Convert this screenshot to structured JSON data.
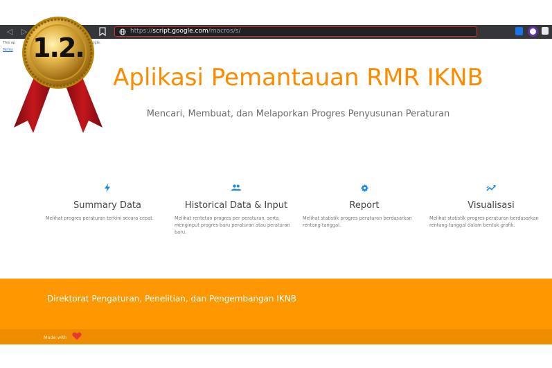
{
  "browser": {
    "url_prefix": "https://",
    "url_domain": "script.google.com",
    "url_path": "/macros/s/"
  },
  "banner": {
    "warning_fragment": "This ap",
    "warning_suffix": "ot by Google.",
    "terms_label": "Terms"
  },
  "badge": {
    "label": "1.2."
  },
  "header": {
    "title": "Aplikasi Pemantauan RMR IKNB",
    "subtitle": "Mencari, Membuat, dan Melaporkan Progres Penyusunan Peraturan"
  },
  "features": [
    {
      "icon": "bolt-icon",
      "title": "Summary Data",
      "description": "Melihat progres peraturan terkini secara cepat."
    },
    {
      "icon": "group-icon",
      "title": "Historical Data & Input",
      "description": "Melihat rentetan progres per peraturan, serta menginput progres baru peraturan atau peraturan baru."
    },
    {
      "icon": "gear-icon",
      "title": "Report",
      "description": "Melihat statistik progres peraturan berdasarkan rentang tanggal."
    },
    {
      "icon": "trending-icon",
      "title": "Visualisasi",
      "description": "Melihat statistik progres peraturan berdasarkan rentang tanggal dalam bentuk grafik."
    }
  ],
  "footer": {
    "org_name": "Direktorat Pengaturan, Penelitian, dan Pengembangan IKNB",
    "made_with": "Made with"
  },
  "colors": {
    "accent": "#fb8c00",
    "footer": "#ff9800",
    "footer_bottom": "#ef8d00",
    "icon_blue": "#1e88e5"
  }
}
